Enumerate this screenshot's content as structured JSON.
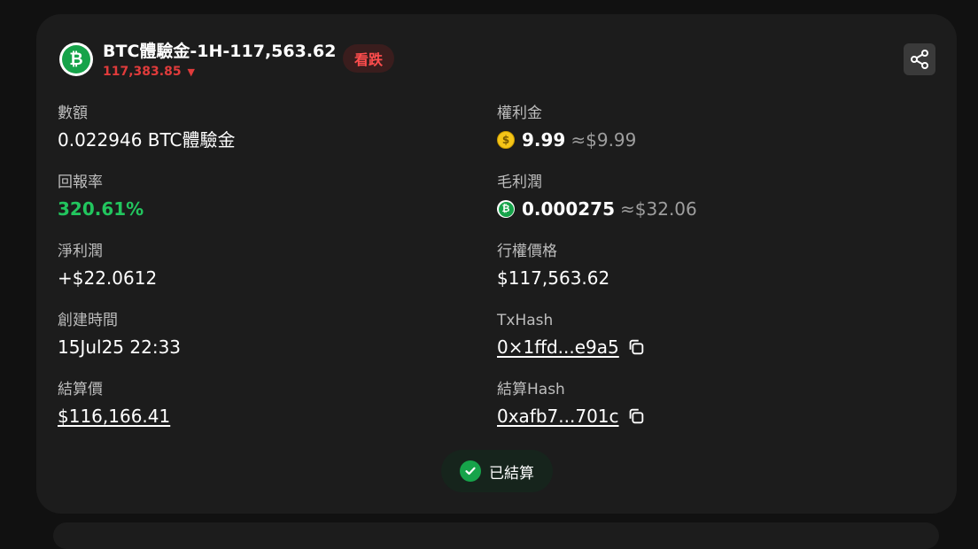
{
  "header": {
    "title": "BTC體驗金-1H-117,563.62",
    "current_price": "117,383.85",
    "direction_arrow": "▼",
    "direction_badge": "看跌",
    "coin_icon": "btc-coin-icon",
    "share_icon": "share-icon"
  },
  "left": {
    "amount": {
      "label": "數額",
      "value": "0.022946 BTC體驗金"
    },
    "return_rate": {
      "label": "回報率",
      "value": "320.61%"
    },
    "net_profit": {
      "label": "淨利潤",
      "value": "+$22.0612"
    },
    "created_time": {
      "label": "創建時間",
      "value": "15Jul25 22:33"
    },
    "settlement_price": {
      "label": "結算價",
      "value": "$116,166.41"
    }
  },
  "right": {
    "premium": {
      "label": "權利金",
      "amount": "9.99",
      "approx": "≈$9.99",
      "icon": "gold-coin-icon"
    },
    "gross_profit": {
      "label": "毛利潤",
      "amount": "0.000275",
      "approx": "≈$32.06",
      "icon": "btc-coin-icon"
    },
    "strike_price": {
      "label": "行權價格",
      "value": "$117,563.62"
    },
    "tx_hash": {
      "label": "TxHash",
      "value": "0×1ffd...e9a5"
    },
    "settle_hash": {
      "label": "結算Hash",
      "value": "0xafb7...701c"
    }
  },
  "status": {
    "label": "已結算",
    "icon": "check-circle-icon"
  },
  "colors": {
    "background": "#111111",
    "card": "#1c1c1c",
    "bearish_red": "#e03b3b",
    "profit_green": "#22c55e"
  }
}
